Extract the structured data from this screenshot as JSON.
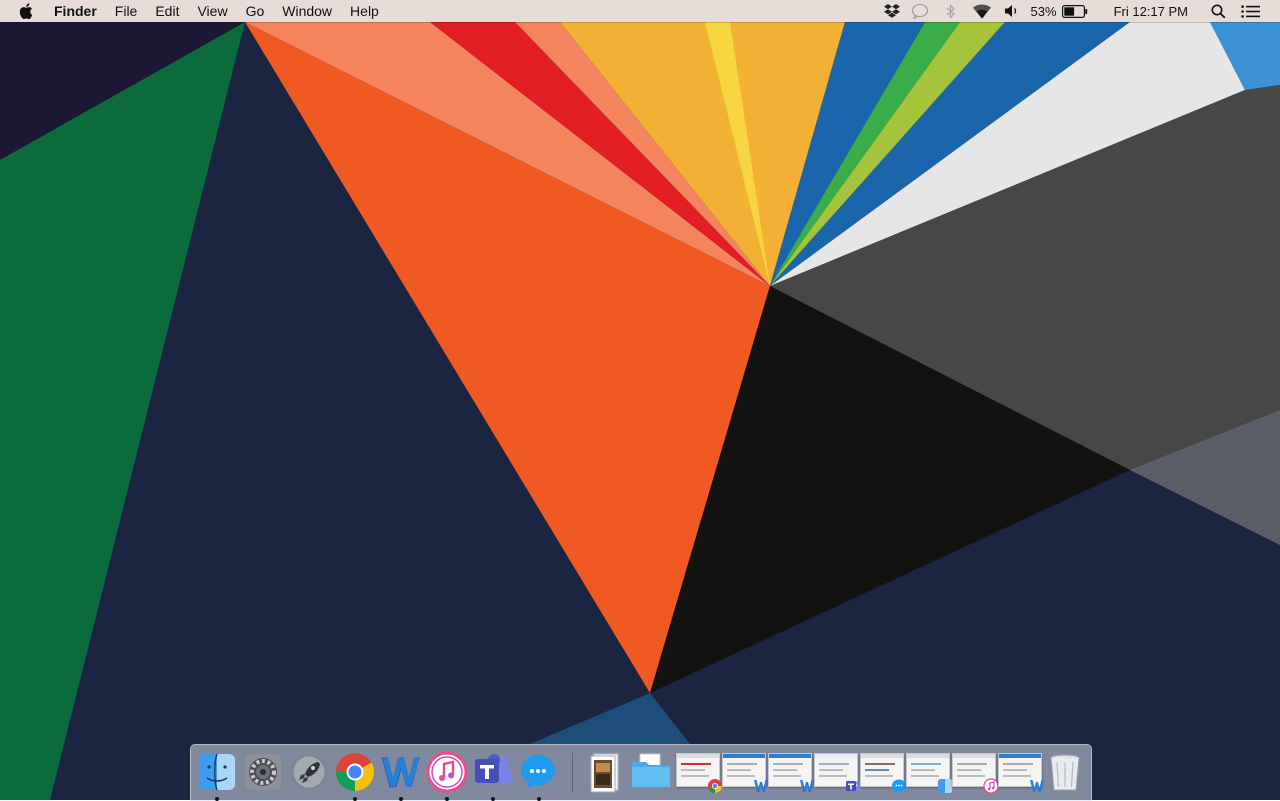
{
  "menubar": {
    "app_name": "Finder",
    "menus": [
      "File",
      "Edit",
      "View",
      "Go",
      "Window",
      "Help"
    ],
    "battery_percent": "53%",
    "clock": "Fri 12:17 PM"
  },
  "status_icons": [
    "dropbox-icon",
    "chat-bubble-icon",
    "bluetooth-icon",
    "wifi-icon",
    "volume-icon",
    "battery-icon",
    "spotlight-search-icon",
    "notification-center-icon"
  ],
  "battery_level": 0.53,
  "dock": {
    "apps": [
      {
        "name": "finder",
        "running": true
      },
      {
        "name": "system-preferences",
        "running": false
      },
      {
        "name": "launchpad",
        "running": false
      },
      {
        "name": "chrome",
        "running": true
      },
      {
        "name": "word",
        "running": true
      },
      {
        "name": "itunes",
        "running": true
      },
      {
        "name": "teams",
        "running": true
      },
      {
        "name": "messenger",
        "running": true
      }
    ],
    "others": [
      "document-stack",
      "downloads-folder",
      "minimized-chrome-window",
      "minimized-word-window-1",
      "minimized-word-window-2",
      "minimized-teams-window",
      "minimized-messenger-window",
      "minimized-finder-window",
      "minimized-itunes-window",
      "minimized-word-window-3",
      "trash"
    ]
  },
  "colors": {
    "menubar_bg": "#f6ece4",
    "wallpaper_navy": "#1b2542",
    "wallpaper_orange": "#f05a22",
    "wallpaper_green": "#0b6b3b",
    "wallpaper_gray": "#474747"
  }
}
